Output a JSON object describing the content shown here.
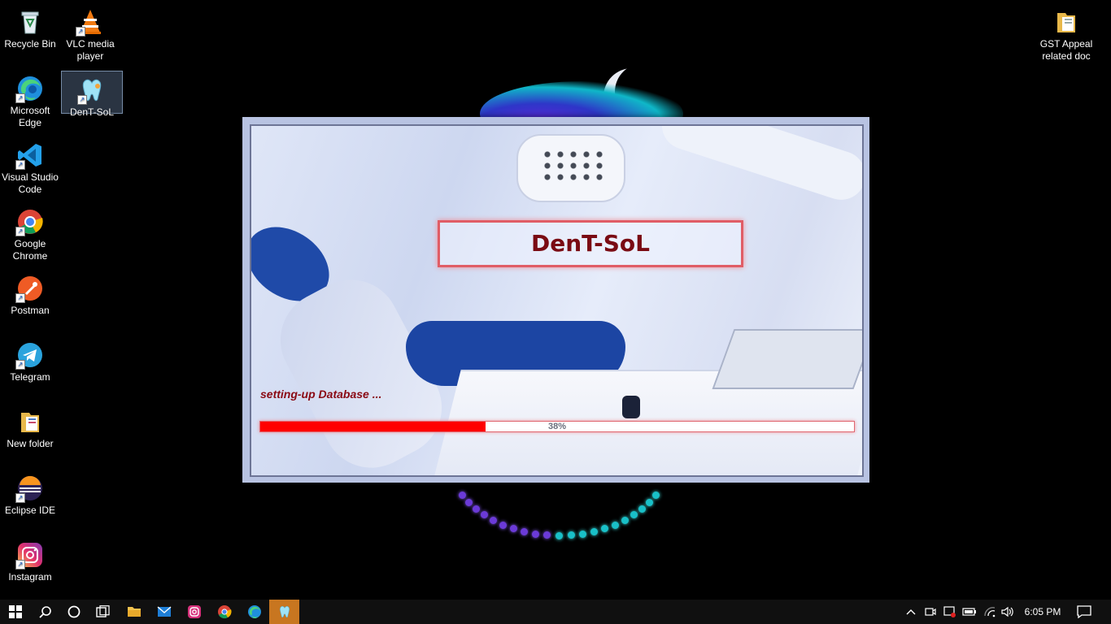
{
  "desktop": {
    "icons": [
      {
        "label": "Recycle Bin",
        "icon": "recycle-bin-icon"
      },
      {
        "label": "VLC media player",
        "icon": "vlc-icon"
      },
      {
        "label": "Microsoft Edge",
        "icon": "edge-icon"
      },
      {
        "label": "DenT-SoL",
        "icon": "dent-sol-app-icon"
      },
      {
        "label": "Visual Studio Code",
        "icon": "vscode-icon"
      },
      {
        "label": "Google Chrome",
        "icon": "chrome-icon"
      },
      {
        "label": "Postman",
        "icon": "postman-icon"
      },
      {
        "label": "Telegram",
        "icon": "telegram-icon"
      },
      {
        "label": "New folder",
        "icon": "folder-icon"
      },
      {
        "label": "Eclipse IDE",
        "icon": "eclipse-icon"
      },
      {
        "label": "Instagram",
        "icon": "instagram-icon"
      },
      {
        "label": "GST Appeal related doc",
        "icon": "folder-icon"
      }
    ]
  },
  "splash": {
    "title": "DenT-SoL",
    "status": "setting-up Database ...",
    "progress_text": "38%",
    "progress_fraction": 0.38,
    "accent": "#ff0000",
    "title_color": "#7a0b13"
  },
  "taskbar": {
    "apps": [
      "start-icon",
      "search-icon",
      "cortana-icon",
      "task-view-icon",
      "file-explorer-icon",
      "mail-icon",
      "instagram-icon",
      "chrome-icon",
      "edge-icon",
      "dent-sol-app-icon"
    ],
    "active_app": "dent-sol-app-icon",
    "clock": "6:05 PM"
  }
}
